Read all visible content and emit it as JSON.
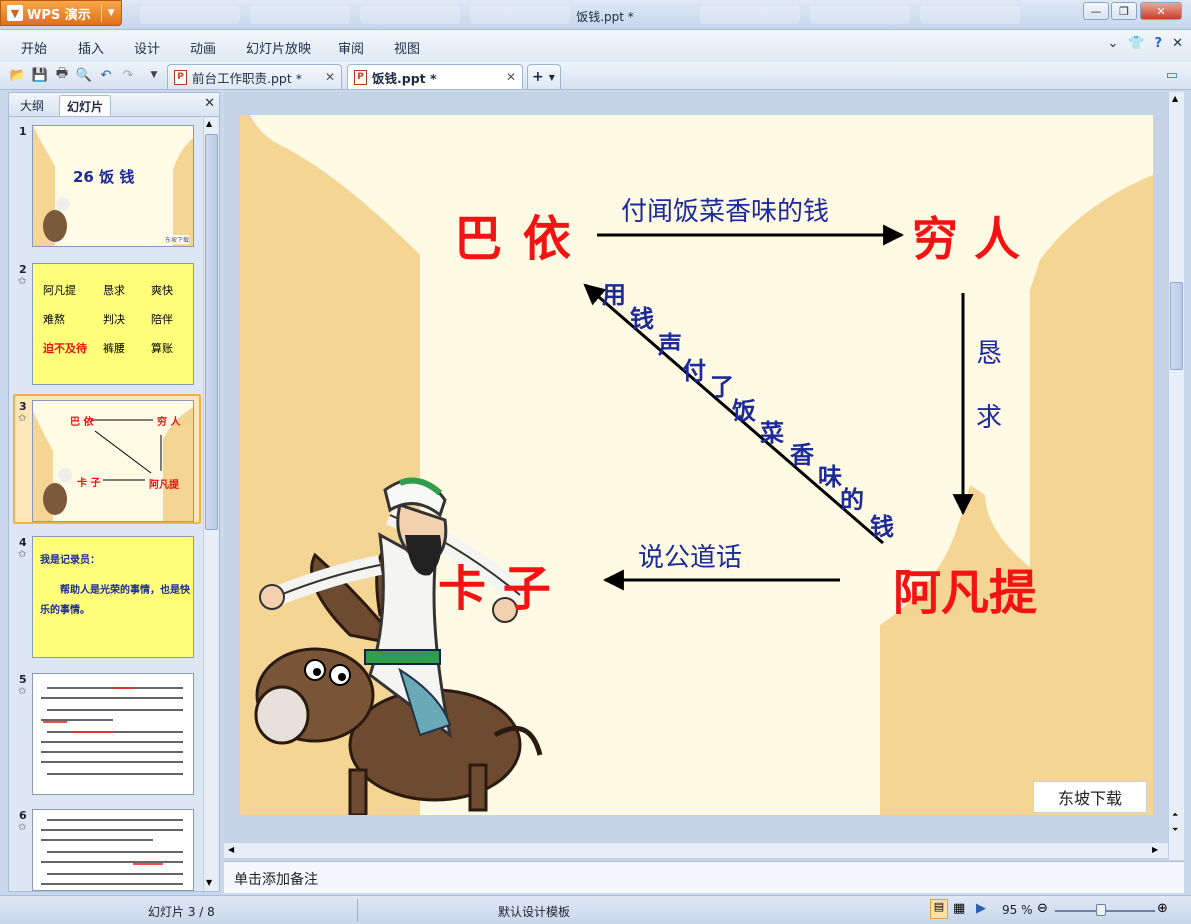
{
  "app": {
    "name": "WPS 演示",
    "window_title": "饭钱.ppt *"
  },
  "menu": [
    "开始",
    "插入",
    "设计",
    "动画",
    "幻灯片放映",
    "审阅",
    "视图"
  ],
  "tabs": [
    {
      "label": "前台工作职责.ppt *",
      "active": false
    },
    {
      "label": "饭钱.ppt *",
      "active": true
    }
  ],
  "left_panel": {
    "tabs": [
      "大纲",
      "幻灯片"
    ],
    "active_tab": "幻灯片",
    "thumbnails": [
      {
        "num": "1",
        "title": "26 饭 钱",
        "badge": "东坡下载"
      },
      {
        "num": "2",
        "words": [
          "阿凡提",
          "恳求",
          "爽快",
          "难熬",
          "判决",
          "陪伴",
          "迫不及待",
          "裤腰",
          "算账"
        ]
      },
      {
        "num": "3",
        "labels": [
          "巴 依",
          "穷 人",
          "卡 子",
          "阿凡提"
        ],
        "selected": true
      },
      {
        "num": "4",
        "lines": [
          "我是记录员：",
          "帮助人是光荣的事情，也是快乐的事情。"
        ]
      },
      {
        "num": "5"
      },
      {
        "num": "6"
      }
    ]
  },
  "slide": {
    "nodes": {
      "bayi": "巴  依",
      "qiongren": "穷 人",
      "afanti": "阿凡提",
      "kazi": "卡 子"
    },
    "edges": {
      "top": "付闻饭菜香味的钱",
      "right_chars": [
        "恳",
        "求"
      ],
      "bottom": "说公道话",
      "diagonal_chars": [
        "用",
        "钱",
        "声",
        "付",
        "了",
        "饭",
        "菜",
        "香",
        "味",
        "的",
        "钱"
      ]
    },
    "watermark": "东坡下载"
  },
  "notes_placeholder": "单击添加备注",
  "status": {
    "slide_index": "幻灯片 3 / 8",
    "template": "默认设计模板",
    "zoom": "95 %"
  },
  "colors": {
    "node_red": "#f41212",
    "edge_blue": "#1d2a9a",
    "slide_bg": "#fffae3",
    "tower_tan": "#f4d594",
    "thumb_yellow": "#ffff7a"
  }
}
